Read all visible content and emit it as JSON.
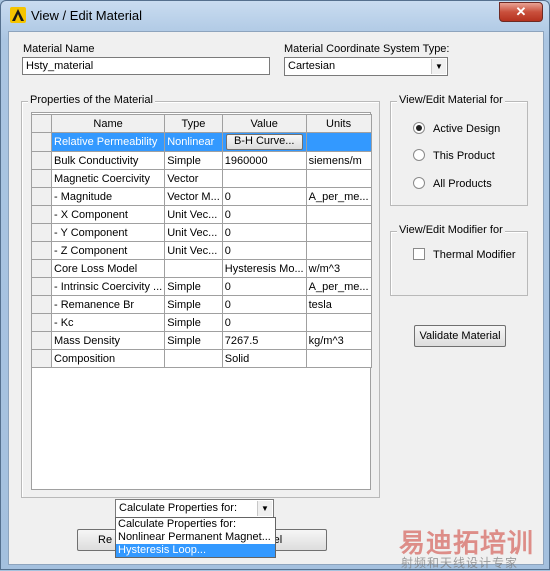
{
  "window": {
    "title": "View / Edit Material",
    "close_label": "✕"
  },
  "material_name": {
    "label": "Material Name",
    "value": "Hsty_material"
  },
  "coord_system": {
    "label": "Material Coordinate System Type:",
    "value": "Cartesian"
  },
  "properties": {
    "title": "Properties of the Material",
    "columns": [
      "Name",
      "Type",
      "Value",
      "Units"
    ],
    "rows": [
      {
        "name": "Relative Permeability",
        "type": "Nonlinear",
        "value": "B-H Curve...",
        "units": ""
      },
      {
        "name": "Bulk Conductivity",
        "type": "Simple",
        "value": "1960000",
        "units": "siemens/m"
      },
      {
        "name": "Magnetic Coercivity",
        "type": "Vector",
        "value": "",
        "units": ""
      },
      {
        "name": "- Magnitude",
        "type": "Vector M...",
        "value": "0",
        "units": "A_per_me..."
      },
      {
        "name": "- X Component",
        "type": "Unit Vec...",
        "value": "0",
        "units": ""
      },
      {
        "name": "- Y Component",
        "type": "Unit Vec...",
        "value": "0",
        "units": ""
      },
      {
        "name": "- Z Component",
        "type": "Unit Vec...",
        "value": "0",
        "units": ""
      },
      {
        "name": "Core Loss Model",
        "type": "",
        "value": "Hysteresis Mo...",
        "units": "w/m^3"
      },
      {
        "name": "- Intrinsic Coercivity ...",
        "type": "Simple",
        "value": "0",
        "units": "A_per_me..."
      },
      {
        "name": "- Remanence Br",
        "type": "Simple",
        "value": "0",
        "units": "tesla"
      },
      {
        "name": "- Kc",
        "type": "Simple",
        "value": "0",
        "units": ""
      },
      {
        "name": "Mass Density",
        "type": "Simple",
        "value": "7267.5",
        "units": "kg/m^3"
      },
      {
        "name": "Composition",
        "type": "",
        "value": "Solid",
        "units": ""
      }
    ]
  },
  "view_edit_for": {
    "title": "View/Edit Material for",
    "options": [
      "Active Design",
      "This Product",
      "All Products"
    ],
    "selected": "Active Design"
  },
  "modifier": {
    "title": "View/Edit Modifier for",
    "thermal_label": "Thermal Modifier"
  },
  "validate_label": "Validate Material",
  "calc": {
    "value": "Calculate Properties for:",
    "options": [
      "Calculate Properties for:",
      "Nonlinear Permanent Magnet...",
      "Hysteresis Loop..."
    ],
    "highlighted": "Hysteresis Loop..."
  },
  "bottom_buttons": {
    "left_partial": "Re",
    "right_partial": "ncel"
  },
  "watermark": {
    "main": "易迪拓培训",
    "sub": "射频和天线设计专家"
  },
  "colors": {
    "selection": "#3399ff",
    "titlebar": "#aac5e2",
    "close": "#c9503c"
  }
}
